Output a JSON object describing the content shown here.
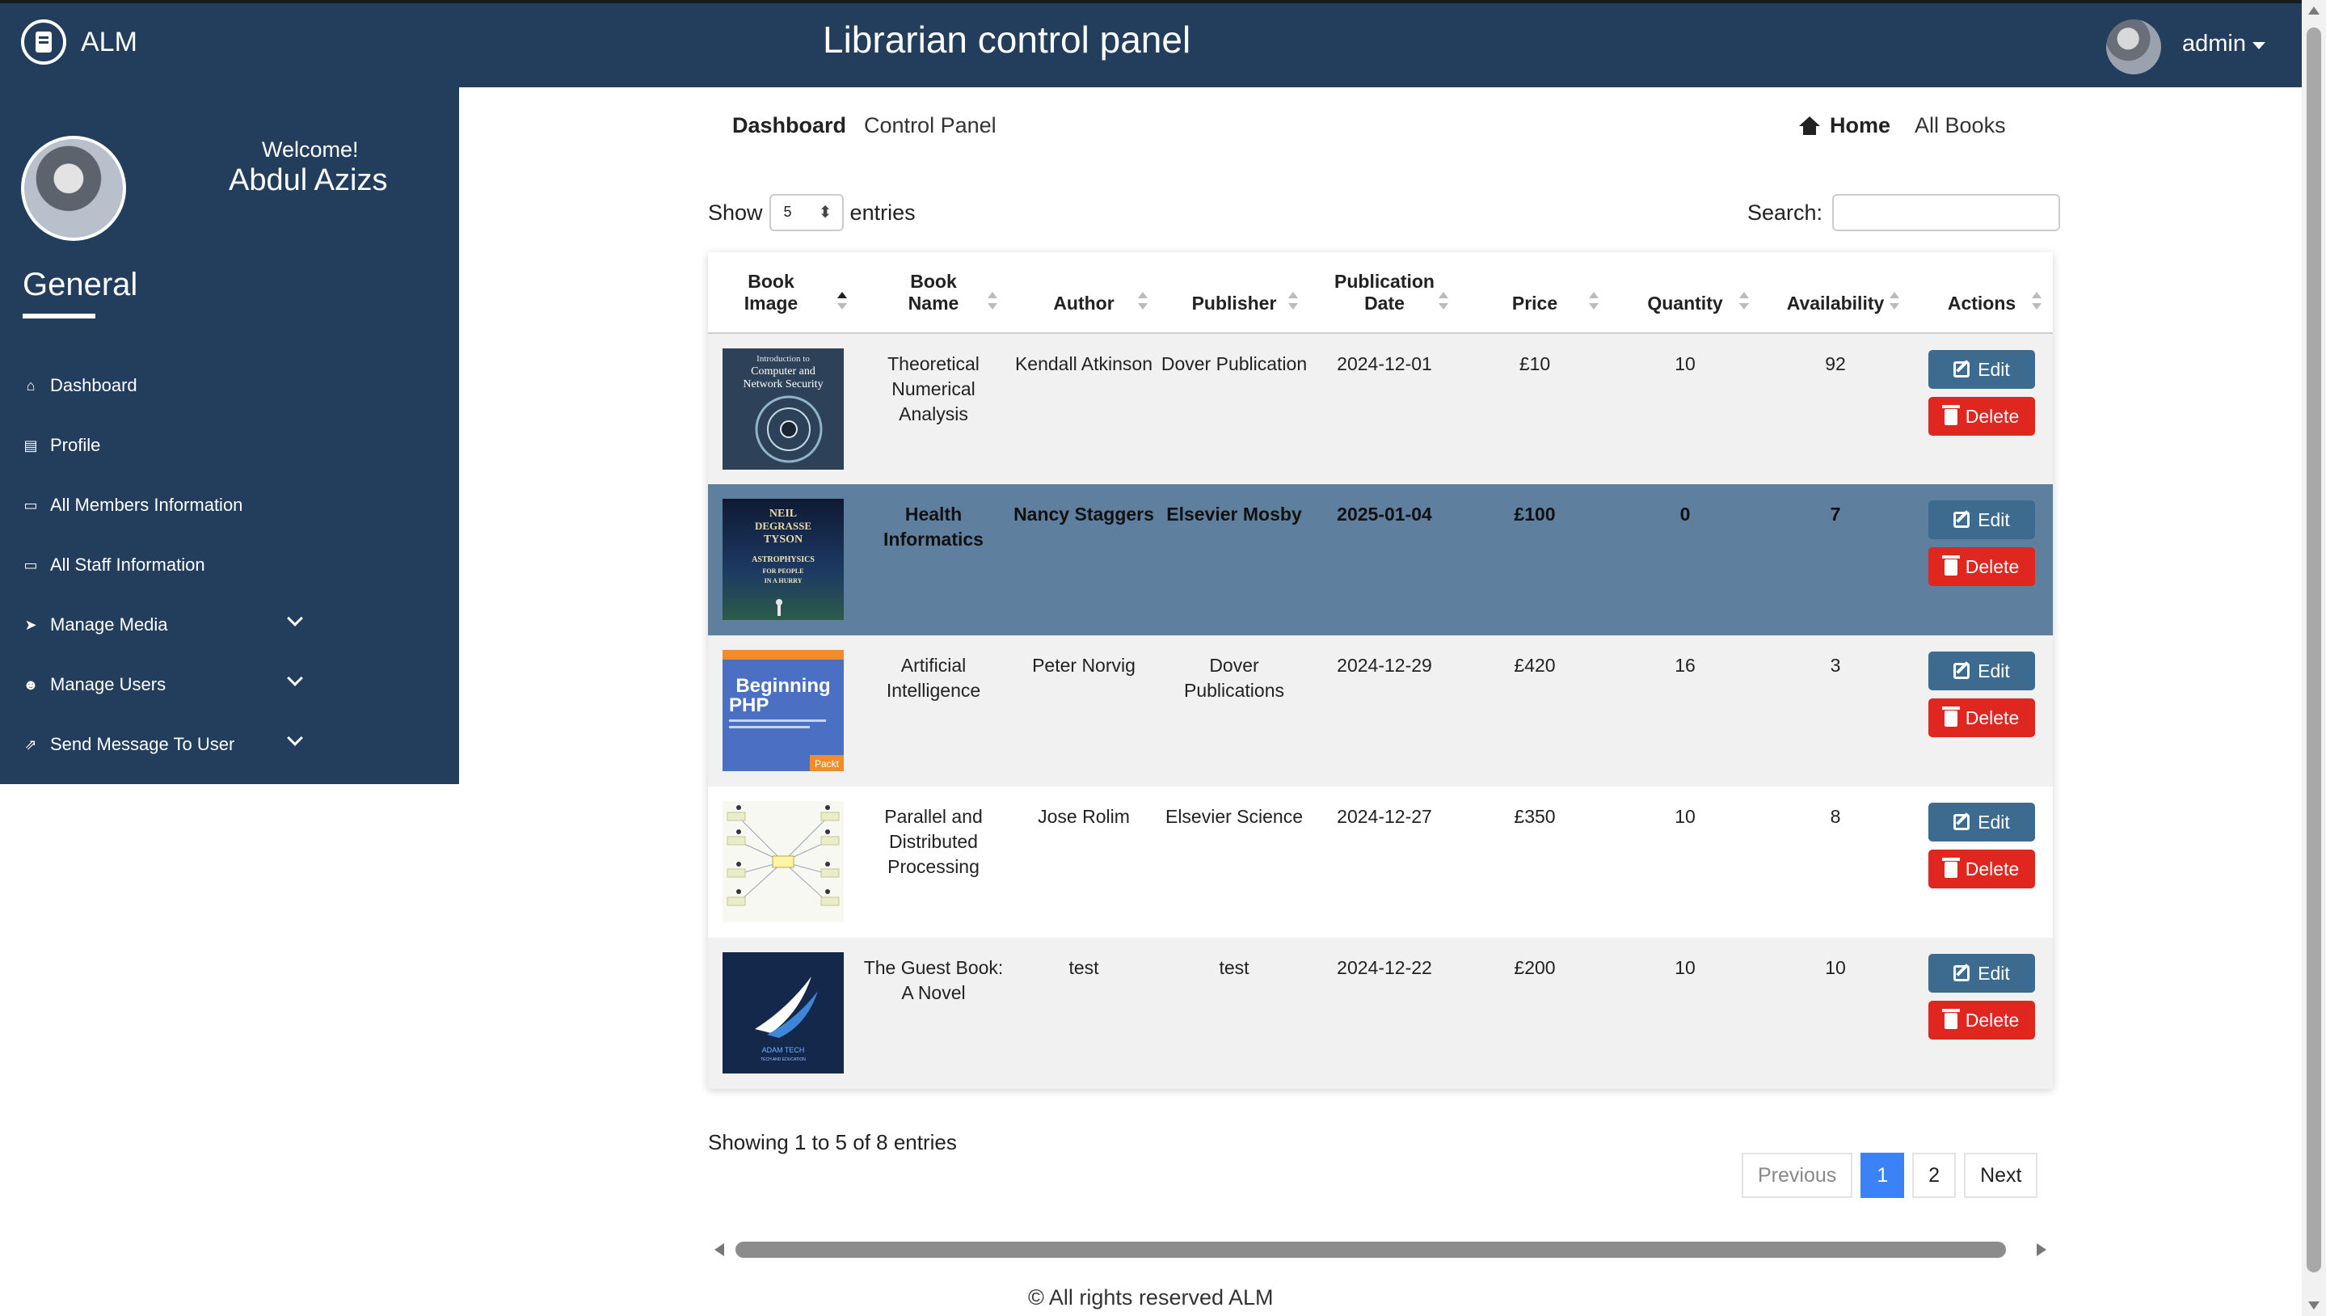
{
  "brand": {
    "name": "ALM"
  },
  "header": {
    "title": "Librarian control panel",
    "user": "admin"
  },
  "sidebar": {
    "welcome": "Welcome!",
    "user_name": "Abdul Azizs",
    "section": "General",
    "items": [
      {
        "label": "Dashboard",
        "icon": "home-icon"
      },
      {
        "label": "Profile",
        "icon": "id-card-icon"
      },
      {
        "label": "All Members Information",
        "icon": "monitor-icon"
      },
      {
        "label": "All Staff Information",
        "icon": "monitor-icon"
      },
      {
        "label": "Manage Media",
        "icon": "paper-plane-icon",
        "expandable": true
      },
      {
        "label": "Manage Users",
        "icon": "users-icon",
        "expandable": true
      },
      {
        "label": "Send Message To User",
        "icon": "share-icon",
        "expandable": true
      }
    ]
  },
  "breadcrumb": {
    "active": "Dashboard",
    "current": "Control Panel"
  },
  "nav_links": {
    "home": "Home",
    "all_books": "All Books"
  },
  "table_controls": {
    "show_label": "Show",
    "entries_value": "5",
    "entries_label": "entries",
    "search_label": "Search:",
    "search_value": ""
  },
  "table": {
    "columns": [
      "Book Image",
      "Book Name",
      "Author",
      "Publisher",
      "Publication Date",
      "Price",
      "Quantity",
      "Availability",
      "Actions"
    ],
    "rows": [
      {
        "name": "Theoretical Numerical Analysis",
        "author": "Kendall Atkinson",
        "publisher": "Dover Publication",
        "date": "2024-12-01",
        "price": "£10",
        "quantity": "10",
        "availability": "92",
        "cover": "network-security-cover"
      },
      {
        "name": "Health Informatics",
        "author": "Nancy Staggers",
        "publisher": "Elsevier Mosby",
        "date": "2025-01-04",
        "price": "£100",
        "quantity": "0",
        "availability": "7",
        "cover": "astrophysics-cover"
      },
      {
        "name": "Artificial Intelligence",
        "author": "Peter Norvig",
        "publisher": "Dover Publications",
        "date": "2024-12-29",
        "price": "£420",
        "quantity": "16",
        "availability": "3",
        "cover": "beginning-php-cover"
      },
      {
        "name": "Parallel and Distributed Processing",
        "author": "Jose Rolim",
        "publisher": "Elsevier Science",
        "date": "2024-12-27",
        "price": "£350",
        "quantity": "10",
        "availability": "8",
        "cover": "mind-map-cover"
      },
      {
        "name": "The Guest Book: A Novel",
        "author": "test",
        "publisher": "test",
        "date": "2024-12-22",
        "price": "£200",
        "quantity": "10",
        "availability": "10",
        "cover": "adam-tech-cover"
      }
    ],
    "edit_label": "Edit",
    "delete_label": "Delete"
  },
  "cover_text": {
    "c1_line1": "Introduction to",
    "c1_line2": "Computer and",
    "c1_line3": "Network Security",
    "c2_line1": "NEIL",
    "c2_line2": "DEGRASSE",
    "c2_line3": "TYSON",
    "c2_line4": "ASTROPHYSICS",
    "c2_line5": "FOR PEOPLE",
    "c2_line6": "IN A HURRY",
    "c3_line1": "Beginning",
    "c3_line2": "PHP",
    "c3_badge": "Packt",
    "c5_line1": "ADAM TECH",
    "c5_line2": "TECH AND EDUCATION"
  },
  "pagination": {
    "summary": "Showing 1 to 5 of 8 entries",
    "previous": "Previous",
    "pages": [
      "1",
      "2"
    ],
    "next": "Next"
  },
  "footer": {
    "text": "© All rights reserved ALM"
  },
  "colors": {
    "navbar": "#233d5c",
    "selected_row": "#5f7f9f",
    "edit_button": "#3d6a8f",
    "delete_button": "#e0271f",
    "active_page": "#3b82f6"
  }
}
